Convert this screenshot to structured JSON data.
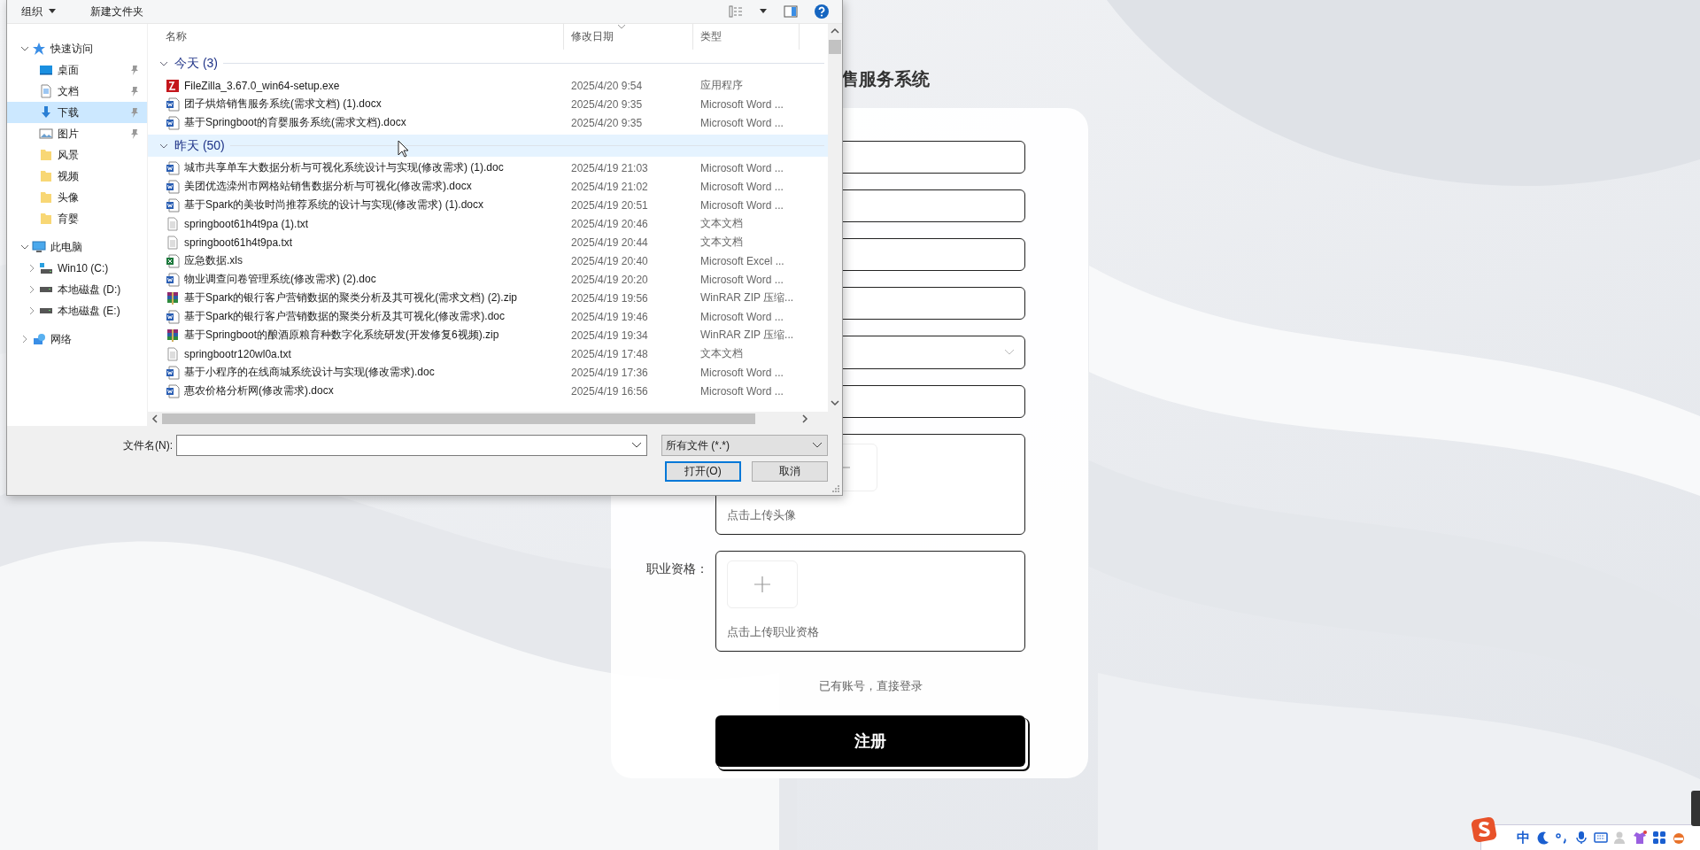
{
  "dialog": {
    "toolbar": [
      {
        "label": "组织",
        "dropdown": true
      },
      {
        "label": "新建文件夹",
        "dropdown": false
      }
    ],
    "nav": [
      {
        "label": "快速访问",
        "kind": "star",
        "expanded": true,
        "selected": false,
        "children": [
          {
            "label": "桌面",
            "kind": "desktop",
            "pinned": true,
            "selected": false
          },
          {
            "label": "文档",
            "kind": "document",
            "pinned": true,
            "selected": false
          },
          {
            "label": "下载",
            "kind": "download",
            "pinned": true,
            "selected": true
          },
          {
            "label": "图片",
            "kind": "pictures",
            "pinned": true,
            "selected": false
          },
          {
            "label": "风景",
            "kind": "folder",
            "pinned": false,
            "selected": false
          },
          {
            "label": "视频",
            "kind": "folder",
            "pinned": false,
            "selected": false
          },
          {
            "label": "头像",
            "kind": "folder",
            "pinned": false,
            "selected": false
          },
          {
            "label": "育婴",
            "kind": "folder",
            "pinned": false,
            "selected": false
          }
        ]
      },
      {
        "label": "此电脑",
        "kind": "computer",
        "expanded": true,
        "selected": false,
        "children": [
          {
            "label": "Win10 (C:)",
            "kind": "system-drive",
            "expanded": false,
            "selected": false
          },
          {
            "label": "本地磁盘 (D:)",
            "kind": "drive",
            "expanded": false,
            "selected": false
          },
          {
            "label": "本地磁盘 (E:)",
            "kind": "drive",
            "expanded": false,
            "selected": false
          }
        ]
      },
      {
        "label": "网络",
        "kind": "network",
        "expanded": false,
        "selected": false
      }
    ],
    "columns": [
      {
        "label": "名称",
        "sorted": false
      },
      {
        "label": "修改日期",
        "sorted": true
      },
      {
        "label": "类型",
        "sorted": false
      }
    ],
    "groups": [
      {
        "label": "今天 (3)",
        "expanded": true,
        "hovered": false,
        "files": [
          {
            "name": "FileZilla_3.67.0_win64-setup.exe",
            "date": "2025/4/20 9:54",
            "type": "应用程序",
            "kind": "exe"
          },
          {
            "name": "团子烘焙销售服务系统(需求文档) (1).docx",
            "date": "2025/4/20 9:35",
            "type": "Microsoft Word ...",
            "kind": "word"
          },
          {
            "name": "基于Springboot的育婴服务系统(需求文档).docx",
            "date": "2025/4/20 9:35",
            "type": "Microsoft Word ...",
            "kind": "word"
          }
        ]
      },
      {
        "label": "昨天 (50)",
        "expanded": true,
        "hovered": true,
        "files": [
          {
            "name": "城市共享单车大数据分析与可视化系统设计与实现(修改需求) (1).doc",
            "date": "2025/4/19 21:03",
            "type": "Microsoft Word ...",
            "kind": "word"
          },
          {
            "name": "美团优选滦州市网格站销售数据分析与可视化(修改需求).docx",
            "date": "2025/4/19 21:02",
            "type": "Microsoft Word ...",
            "kind": "word"
          },
          {
            "name": "基于Spark的美妆时尚推荐系统的设计与实现(修改需求) (1).docx",
            "date": "2025/4/19 20:51",
            "type": "Microsoft Word ...",
            "kind": "word"
          },
          {
            "name": "springboot61h4t9pa (1).txt",
            "date": "2025/4/19 20:46",
            "type": "文本文档",
            "kind": "text"
          },
          {
            "name": "springboot61h4t9pa.txt",
            "date": "2025/4/19 20:44",
            "type": "文本文档",
            "kind": "text"
          },
          {
            "name": "应急数据.xls",
            "date": "2025/4/19 20:40",
            "type": "Microsoft Excel ...",
            "kind": "excel"
          },
          {
            "name": "物业调查问卷管理系统(修改需求) (2).doc",
            "date": "2025/4/19 20:20",
            "type": "Microsoft Word ...",
            "kind": "word"
          },
          {
            "name": "基于Spark的银行客户营销数据的聚类分析及其可视化(需求文档) (2).zip",
            "date": "2025/4/19 19:56",
            "type": "WinRAR ZIP 压缩...",
            "kind": "archive"
          },
          {
            "name": "基于Spark的银行客户营销数据的聚类分析及其可视化(修改需求).doc",
            "date": "2025/4/19 19:46",
            "type": "Microsoft Word ...",
            "kind": "word"
          },
          {
            "name": "基于Springboot的酿酒原粮育种数字化系统研发(开发修复6视频).zip",
            "date": "2025/4/19 19:34",
            "type": "WinRAR ZIP 压缩...",
            "kind": "archive"
          },
          {
            "name": "springbootr120wl0a.txt",
            "date": "2025/4/19 17:48",
            "type": "文本文档",
            "kind": "text"
          },
          {
            "name": "基于小程序的在线商城系统设计与实现(修改需求).doc",
            "date": "2025/4/19 17:36",
            "type": "Microsoft Word ...",
            "kind": "word"
          },
          {
            "name": "惠农价格分析网(修改需求).docx",
            "date": "2025/4/19 16:56",
            "type": "Microsoft Word ...",
            "kind": "word"
          }
        ]
      }
    ],
    "filename_label": "文件名(N):",
    "filter": "所有文件 (*.*)",
    "buttons": [
      {
        "label": "打开(O)",
        "default": true
      },
      {
        "label": "取消",
        "default": false
      }
    ]
  },
  "form": {
    "title": "售服务系统",
    "fields": [
      {
        "kind": "input"
      },
      {
        "kind": "input"
      },
      {
        "kind": "input"
      },
      {
        "kind": "input"
      },
      {
        "kind": "select"
      },
      {
        "kind": "input"
      }
    ],
    "uploads": [
      {
        "hint": "点击上传头像"
      },
      {
        "label": "职业资格：",
        "hint": "点击上传职业资格"
      }
    ],
    "login_link": "已有账号，直接登录",
    "submit": "注册"
  },
  "ime_bar": {
    "mode": "中"
  }
}
